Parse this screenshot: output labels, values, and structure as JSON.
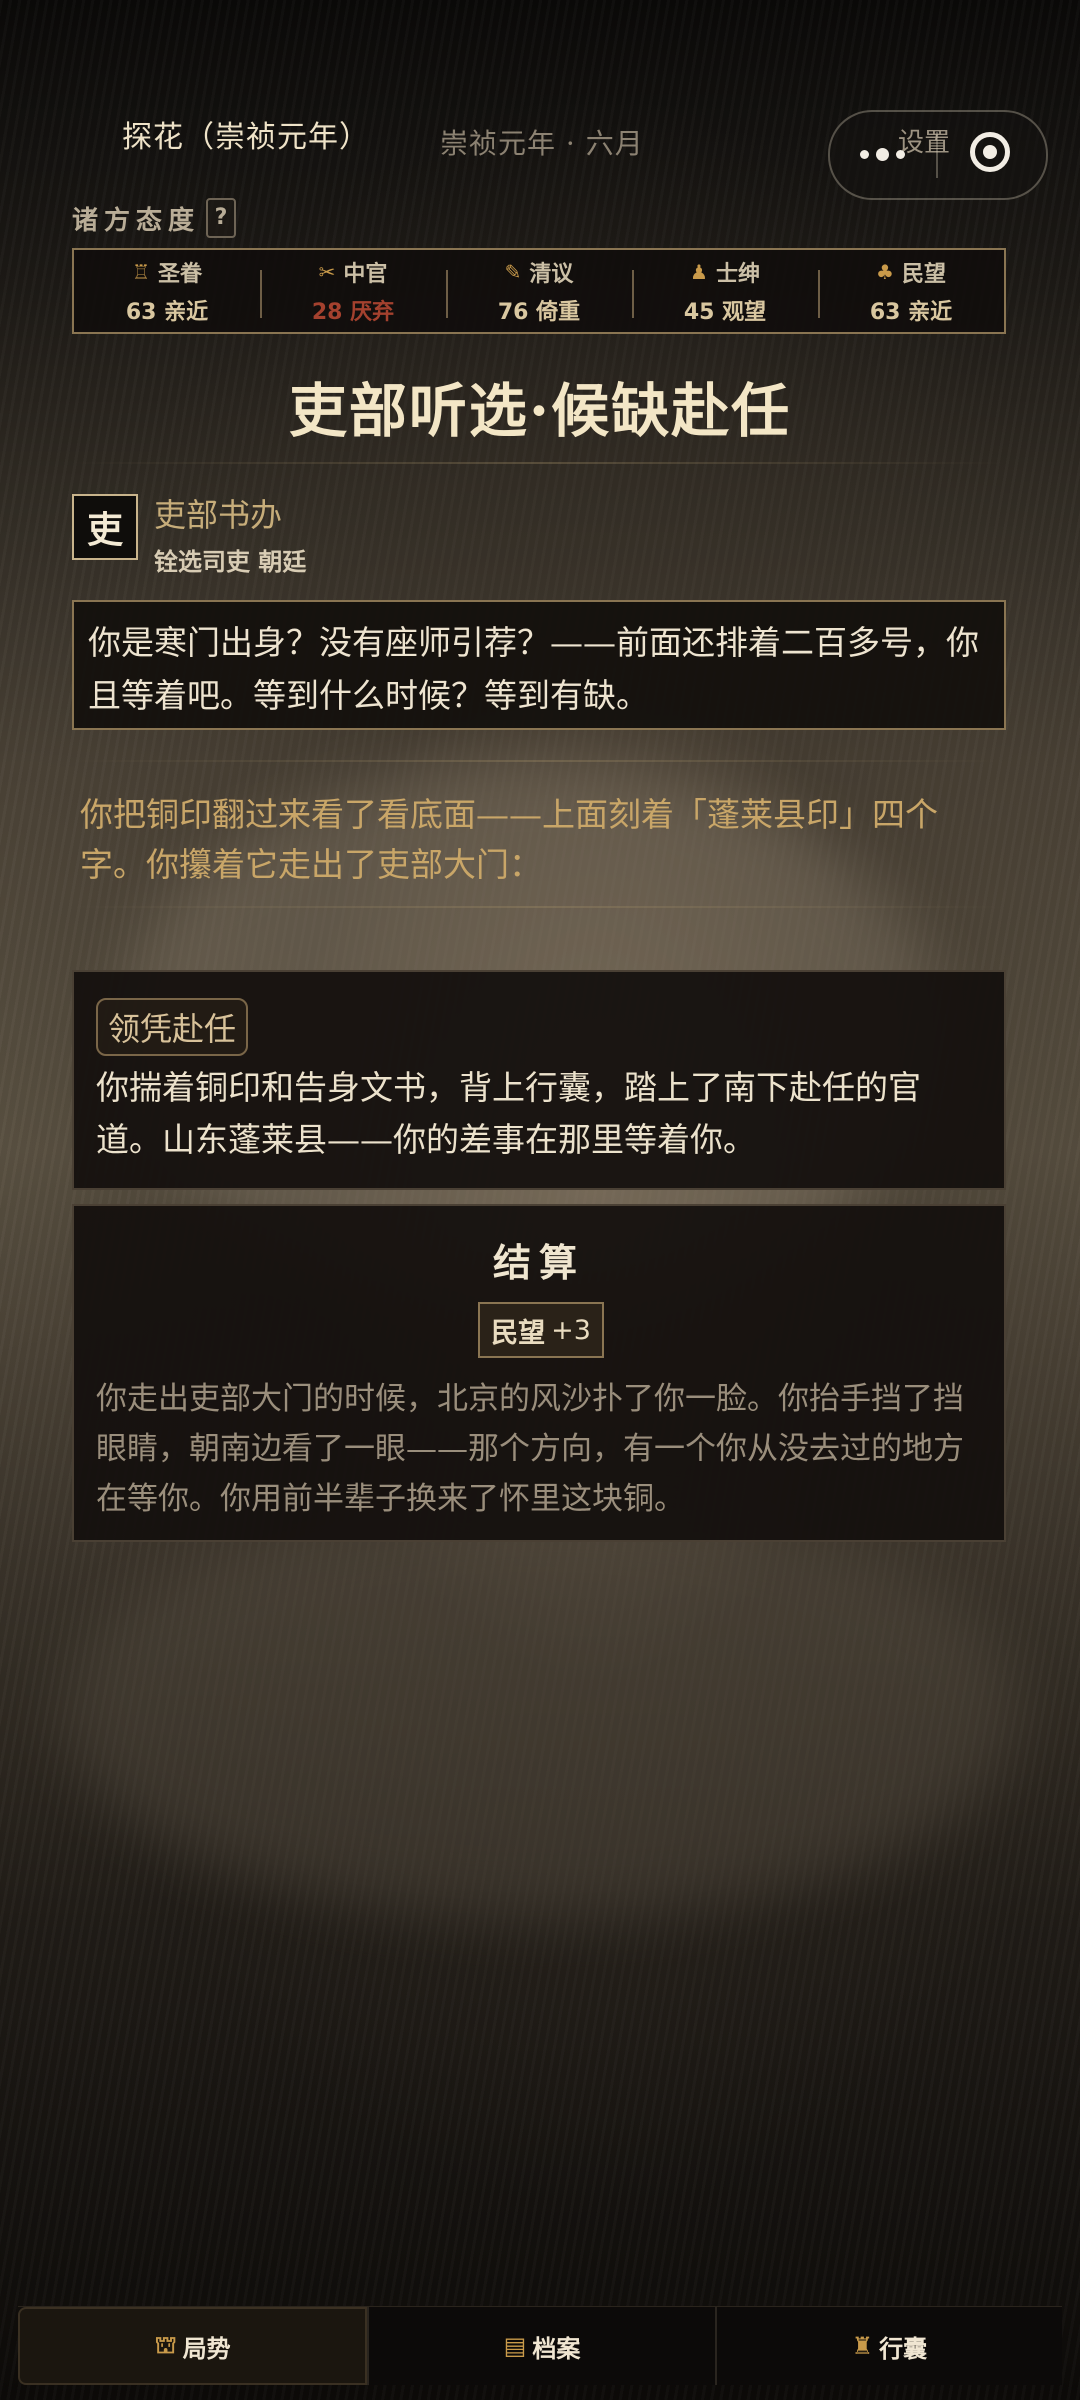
{
  "topbar": {
    "rank": "探花（崇祯元年）",
    "date": "崇祯元年 · 六月",
    "settings_label": "设置"
  },
  "attitude": {
    "title": "诸方态度",
    "help": "?",
    "factions": [
      {
        "icon": "♖",
        "icon_name": "emperor-icon",
        "name": "圣眷",
        "value": "63",
        "status": "亲近",
        "tone": "positive"
      },
      {
        "icon": "✂",
        "icon_name": "eunuch-icon",
        "name": "中官",
        "value": "28",
        "status": "厌弃",
        "tone": "negative"
      },
      {
        "icon": "✎",
        "icon_name": "literati-icon",
        "name": "清议",
        "value": "76",
        "status": "倚重",
        "tone": "positive"
      },
      {
        "icon": "♟",
        "icon_name": "gentry-icon",
        "name": "士绅",
        "value": "45",
        "status": "观望",
        "tone": "neutral"
      },
      {
        "icon": "♣",
        "icon_name": "people-icon",
        "name": "民望",
        "value": "63",
        "status": "亲近",
        "tone": "positive"
      }
    ]
  },
  "event": {
    "title": "吏部听选·候缺赴任",
    "speaker": {
      "seal": "吏",
      "name": "吏部书办",
      "role": "铨选司吏 朝廷"
    },
    "dialog": "你是寒门出身？没有座师引荐？——前面还排着二百多号，你且等着吧。等到什么时候？等到有缺。",
    "narration": "你把铜印翻过来看了看底面——上面刻着「蓬莱县印」四个字。你攥着它走出了吏部大门："
  },
  "choice": {
    "tag": "领凭赴任",
    "text": "你揣着铜印和告身文书，背上行囊，踏上了南下赴任的官道。山东蓬莱县——你的差事在那里等着你。"
  },
  "settlement": {
    "title": "结算",
    "reward_label": "民望",
    "reward_value": "+3",
    "text": "你走出吏部大门的时候，北京的风沙扑了你一脸。你抬手挡了挡眼睛，朝南边看了一眼——那个方向，有一个你从没去过的地方在等你。你用前半辈子换来了怀里这块铜。"
  },
  "nav": [
    {
      "icon": "⛫",
      "icon_name": "situation-icon",
      "label": "局势",
      "active": true
    },
    {
      "icon": "▤",
      "icon_name": "archive-icon",
      "label": "档案",
      "active": false
    },
    {
      "icon": "♜",
      "icon_name": "bag-icon",
      "label": "行囊",
      "active": false
    }
  ],
  "colors": {
    "accent_gold": "#c99a4a",
    "negative_red": "#a4412e",
    "panel_border": "#8a7552"
  }
}
